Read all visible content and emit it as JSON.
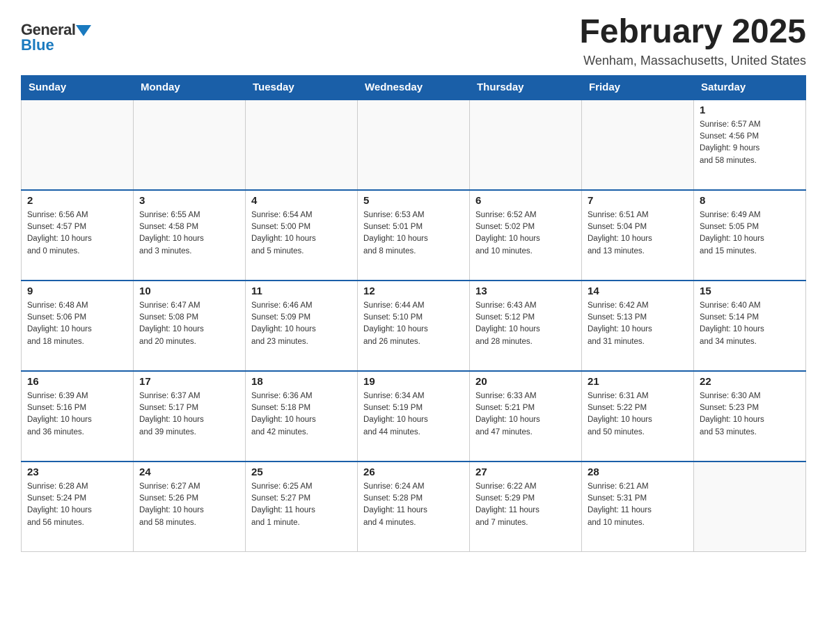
{
  "header": {
    "logo_general": "General",
    "logo_blue": "Blue",
    "title": "February 2025",
    "location": "Wenham, Massachusetts, United States"
  },
  "days_of_week": [
    "Sunday",
    "Monday",
    "Tuesday",
    "Wednesday",
    "Thursday",
    "Friday",
    "Saturday"
  ],
  "weeks": [
    {
      "days": [
        {
          "num": "",
          "info": ""
        },
        {
          "num": "",
          "info": ""
        },
        {
          "num": "",
          "info": ""
        },
        {
          "num": "",
          "info": ""
        },
        {
          "num": "",
          "info": ""
        },
        {
          "num": "",
          "info": ""
        },
        {
          "num": "1",
          "info": "Sunrise: 6:57 AM\nSunset: 4:56 PM\nDaylight: 9 hours\nand 58 minutes."
        }
      ]
    },
    {
      "days": [
        {
          "num": "2",
          "info": "Sunrise: 6:56 AM\nSunset: 4:57 PM\nDaylight: 10 hours\nand 0 minutes."
        },
        {
          "num": "3",
          "info": "Sunrise: 6:55 AM\nSunset: 4:58 PM\nDaylight: 10 hours\nand 3 minutes."
        },
        {
          "num": "4",
          "info": "Sunrise: 6:54 AM\nSunset: 5:00 PM\nDaylight: 10 hours\nand 5 minutes."
        },
        {
          "num": "5",
          "info": "Sunrise: 6:53 AM\nSunset: 5:01 PM\nDaylight: 10 hours\nand 8 minutes."
        },
        {
          "num": "6",
          "info": "Sunrise: 6:52 AM\nSunset: 5:02 PM\nDaylight: 10 hours\nand 10 minutes."
        },
        {
          "num": "7",
          "info": "Sunrise: 6:51 AM\nSunset: 5:04 PM\nDaylight: 10 hours\nand 13 minutes."
        },
        {
          "num": "8",
          "info": "Sunrise: 6:49 AM\nSunset: 5:05 PM\nDaylight: 10 hours\nand 15 minutes."
        }
      ]
    },
    {
      "days": [
        {
          "num": "9",
          "info": "Sunrise: 6:48 AM\nSunset: 5:06 PM\nDaylight: 10 hours\nand 18 minutes."
        },
        {
          "num": "10",
          "info": "Sunrise: 6:47 AM\nSunset: 5:08 PM\nDaylight: 10 hours\nand 20 minutes."
        },
        {
          "num": "11",
          "info": "Sunrise: 6:46 AM\nSunset: 5:09 PM\nDaylight: 10 hours\nand 23 minutes."
        },
        {
          "num": "12",
          "info": "Sunrise: 6:44 AM\nSunset: 5:10 PM\nDaylight: 10 hours\nand 26 minutes."
        },
        {
          "num": "13",
          "info": "Sunrise: 6:43 AM\nSunset: 5:12 PM\nDaylight: 10 hours\nand 28 minutes."
        },
        {
          "num": "14",
          "info": "Sunrise: 6:42 AM\nSunset: 5:13 PM\nDaylight: 10 hours\nand 31 minutes."
        },
        {
          "num": "15",
          "info": "Sunrise: 6:40 AM\nSunset: 5:14 PM\nDaylight: 10 hours\nand 34 minutes."
        }
      ]
    },
    {
      "days": [
        {
          "num": "16",
          "info": "Sunrise: 6:39 AM\nSunset: 5:16 PM\nDaylight: 10 hours\nand 36 minutes."
        },
        {
          "num": "17",
          "info": "Sunrise: 6:37 AM\nSunset: 5:17 PM\nDaylight: 10 hours\nand 39 minutes."
        },
        {
          "num": "18",
          "info": "Sunrise: 6:36 AM\nSunset: 5:18 PM\nDaylight: 10 hours\nand 42 minutes."
        },
        {
          "num": "19",
          "info": "Sunrise: 6:34 AM\nSunset: 5:19 PM\nDaylight: 10 hours\nand 44 minutes."
        },
        {
          "num": "20",
          "info": "Sunrise: 6:33 AM\nSunset: 5:21 PM\nDaylight: 10 hours\nand 47 minutes."
        },
        {
          "num": "21",
          "info": "Sunrise: 6:31 AM\nSunset: 5:22 PM\nDaylight: 10 hours\nand 50 minutes."
        },
        {
          "num": "22",
          "info": "Sunrise: 6:30 AM\nSunset: 5:23 PM\nDaylight: 10 hours\nand 53 minutes."
        }
      ]
    },
    {
      "days": [
        {
          "num": "23",
          "info": "Sunrise: 6:28 AM\nSunset: 5:24 PM\nDaylight: 10 hours\nand 56 minutes."
        },
        {
          "num": "24",
          "info": "Sunrise: 6:27 AM\nSunset: 5:26 PM\nDaylight: 10 hours\nand 58 minutes."
        },
        {
          "num": "25",
          "info": "Sunrise: 6:25 AM\nSunset: 5:27 PM\nDaylight: 11 hours\nand 1 minute."
        },
        {
          "num": "26",
          "info": "Sunrise: 6:24 AM\nSunset: 5:28 PM\nDaylight: 11 hours\nand 4 minutes."
        },
        {
          "num": "27",
          "info": "Sunrise: 6:22 AM\nSunset: 5:29 PM\nDaylight: 11 hours\nand 7 minutes."
        },
        {
          "num": "28",
          "info": "Sunrise: 6:21 AM\nSunset: 5:31 PM\nDaylight: 11 hours\nand 10 minutes."
        },
        {
          "num": "",
          "info": ""
        }
      ]
    }
  ]
}
